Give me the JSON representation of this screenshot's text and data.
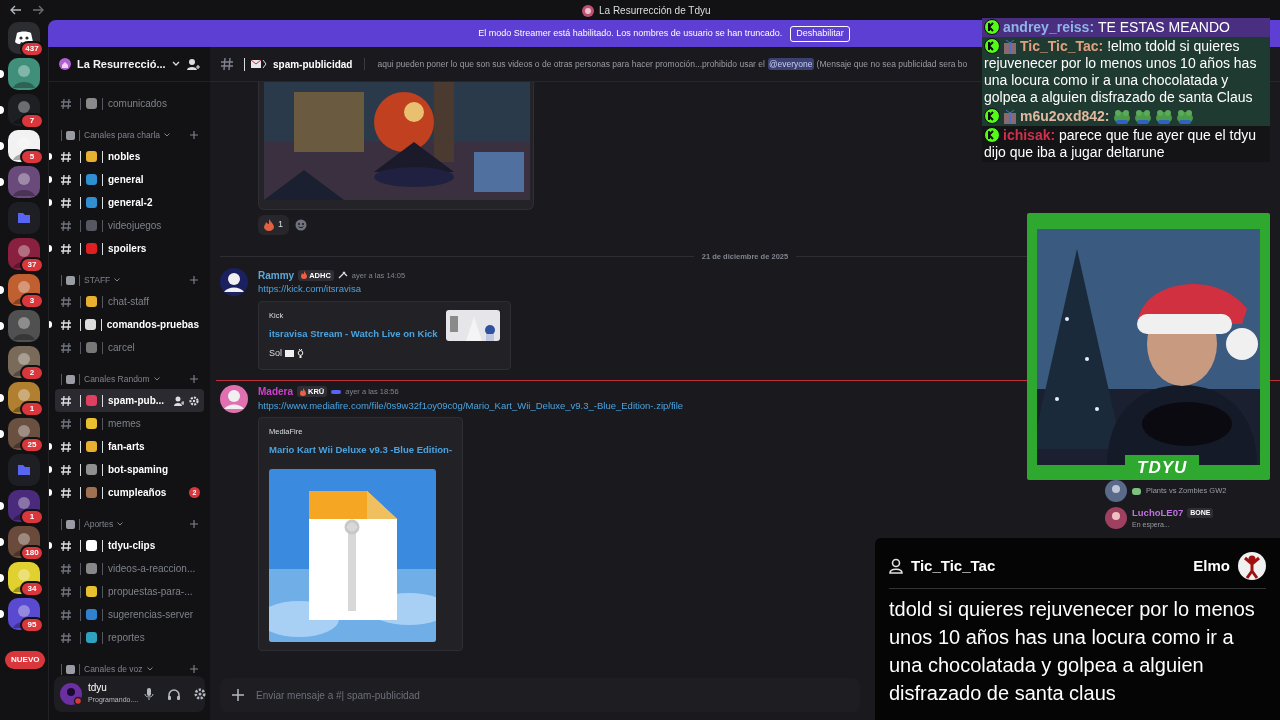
{
  "window": {
    "title": "La Resurrección de Tdyu"
  },
  "streamer_banner": {
    "text": "El modo Streamer está habilitado. Los nombres de usuario se han truncado.",
    "button": "Deshabilitar"
  },
  "servers": [
    {
      "kind": "home",
      "badge": "437",
      "unread": false,
      "color": "#2b2d31"
    },
    {
      "kind": "server",
      "unread": true,
      "color": "#3f8f7a"
    },
    {
      "kind": "server",
      "unread": true,
      "color": "#1e1f22",
      "badge": "7"
    },
    {
      "kind": "server",
      "unread": true,
      "color": "#f2f2f2",
      "badge": "5"
    },
    {
      "kind": "server",
      "unread": true,
      "color": "#6a4a7a"
    },
    {
      "kind": "folder",
      "unread": false,
      "color": "#1e1f24"
    },
    {
      "kind": "server",
      "unread": false,
      "color": "#8a2040",
      "badge": "37"
    },
    {
      "kind": "server",
      "unread": true,
      "color": "#c06030",
      "badge": "3"
    },
    {
      "kind": "server",
      "unread": true,
      "color": "#505050"
    },
    {
      "kind": "server",
      "unread": false,
      "color": "#7a6a5a",
      "badge": "2"
    },
    {
      "kind": "server",
      "unread": true,
      "color": "#b08030",
      "badge": "1"
    },
    {
      "kind": "server",
      "unread": true,
      "color": "#6a5040",
      "badge": "25"
    },
    {
      "kind": "folder",
      "unread": false,
      "color": "#1e1f24"
    },
    {
      "kind": "server",
      "unread": true,
      "color": "#4a2a7a",
      "badge": "1"
    },
    {
      "kind": "server",
      "unread": true,
      "color": "#6a4a3a",
      "badge": "180"
    },
    {
      "kind": "server",
      "unread": true,
      "color": "#e0d030",
      "badge": "34"
    },
    {
      "kind": "server",
      "unread": true,
      "color": "#5a4ad0",
      "badge": "95"
    }
  ],
  "new_badge": "NUEVO",
  "server": {
    "name": "La Resurrecció..."
  },
  "top_channels": [
    {
      "name": "comunicados",
      "unread": false,
      "selected": false,
      "color": "#8a8a8a"
    }
  ],
  "categories": [
    {
      "name": "Canales para charla",
      "channels": [
        {
          "name": "nobles",
          "unread": true,
          "selected": false,
          "color": "#e8b030"
        },
        {
          "name": "general",
          "unread": true,
          "selected": false,
          "color": "#2f8fd0"
        },
        {
          "name": "general-2",
          "unread": true,
          "selected": false,
          "color": "#2f8fd0"
        },
        {
          "name": "videojuegos",
          "unread": false,
          "selected": false,
          "color": "#555860"
        },
        {
          "name": "spoilers",
          "unread": true,
          "selected": false,
          "color": "#e02020"
        }
      ]
    },
    {
      "name": "STAFF",
      "channels": [
        {
          "name": "chat-staff",
          "unread": false,
          "selected": false,
          "color": "#e8b030"
        },
        {
          "name": "comandos-pruebas",
          "unread": true,
          "selected": false,
          "color": "#dddddd"
        },
        {
          "name": "carcel",
          "unread": false,
          "selected": false,
          "color": "#777777"
        }
      ]
    },
    {
      "name": "Canales Random",
      "channels": [
        {
          "name": "spam-pub...",
          "unread": false,
          "selected": true,
          "color": "#e04060"
        },
        {
          "name": "memes",
          "unread": false,
          "selected": false,
          "color": "#e8c030"
        },
        {
          "name": "fan-arts",
          "unread": true,
          "selected": false,
          "color": "#e8b030"
        },
        {
          "name": "bot-spaming",
          "unread": true,
          "selected": false,
          "color": "#909090"
        },
        {
          "name": "cumpleaños",
          "unread": true,
          "selected": false,
          "color": "#a07050",
          "badge": "2"
        }
      ]
    },
    {
      "name": "Aportes",
      "channels": [
        {
          "name": "tdyu-clips",
          "unread": true,
          "selected": false,
          "color": "#ffffff"
        },
        {
          "name": "videos-a-reaccion...",
          "unread": false,
          "selected": false,
          "color": "#888888"
        },
        {
          "name": "propuestas-para-...",
          "unread": false,
          "selected": false,
          "color": "#e8c030"
        },
        {
          "name": "sugerencias-server",
          "unread": false,
          "selected": false,
          "color": "#3080d0"
        },
        {
          "name": "reportes",
          "unread": false,
          "selected": false,
          "color": "#30a0c0"
        }
      ]
    },
    {
      "name": "Canales de voz"
    }
  ],
  "user": {
    "name": "tdyu",
    "status": "Programando...."
  },
  "channel_header": {
    "name": "spam-publicidad",
    "topic_before": "aqui pueden poner lo que son sus videos o de otras personas para hacer promoción...prohibido usar el",
    "mention": "@everyone",
    "topic_after": "(Mensaje que no sea publicidad sera bo"
  },
  "messages": [
    {
      "kind": "attachment",
      "reaction_count": "1"
    },
    {
      "kind": "date",
      "text": "21 de diciembre de 2025"
    },
    {
      "kind": "message",
      "author": "Rammy",
      "color": "#5ea8d8",
      "badge": "ADHC",
      "time": "ayer a las 14:05",
      "link": "https://kick.com/itsravisa",
      "embed": {
        "provider": "Kick",
        "title": "itsravisa Stream - Watch Live on Kick",
        "description": "Sol"
      }
    },
    {
      "kind": "new"
    },
    {
      "kind": "message",
      "author": "Madera",
      "color": "#d040d0",
      "badge": "KRŪ",
      "time": "ayer a las 18:56",
      "link": "https://www.mediafire.com/file/0s9w32f1oy09c0g/Mario_Kart_Wii_Deluxe_v9.3_-Blue_Edition-.zip/file",
      "embed": {
        "provider": "MediaFire",
        "title": "Mario Kart Wii Deluxe v9.3 -Blue Edition-"
      }
    }
  ],
  "composer": {
    "placeholder": "Enviar mensaje a #| spam-publicidad"
  },
  "stream_chat": [
    {
      "gift": false,
      "user": "andrey_reiss:",
      "color": "#8fb4e8",
      "kind": "text",
      "text": "TE ESTAS MEANDO"
    },
    {
      "gift": true,
      "user": "Tic_Tic_Tac:",
      "color": "#e0a080",
      "kind": "text",
      "text": "!elmo tdold si quieres rejuvenecer por lo menos unos 10 años has una locura como ir a una chocolatada y golpea a alguien disfrazado de santa Claus"
    },
    {
      "gift": true,
      "user": "m6u2oxd842:",
      "color": "#e0b8a0",
      "kind": "emotes"
    },
    {
      "gift": false,
      "user": "ichisak:",
      "color": "#d0304a",
      "kind": "text",
      "text": "parece que fue ayer que el tdyu dijo que iba a jugar deltarune"
    }
  ],
  "webcam": {
    "label": "TDYU"
  },
  "member_list": [
    {
      "activity": "Plants vs Zombies GW2"
    },
    {
      "name": "LuchoLE07",
      "badge": "BONE",
      "status": "En espera..."
    }
  ],
  "tts": {
    "user": "Tic_Tic_Tac",
    "voice": "Elmo",
    "text": "tdold si quieres rejuvenecer por lo menos unos 10 años has una locura como ir a una chocolatada y golpea a alguien disfrazado de santa claus"
  }
}
